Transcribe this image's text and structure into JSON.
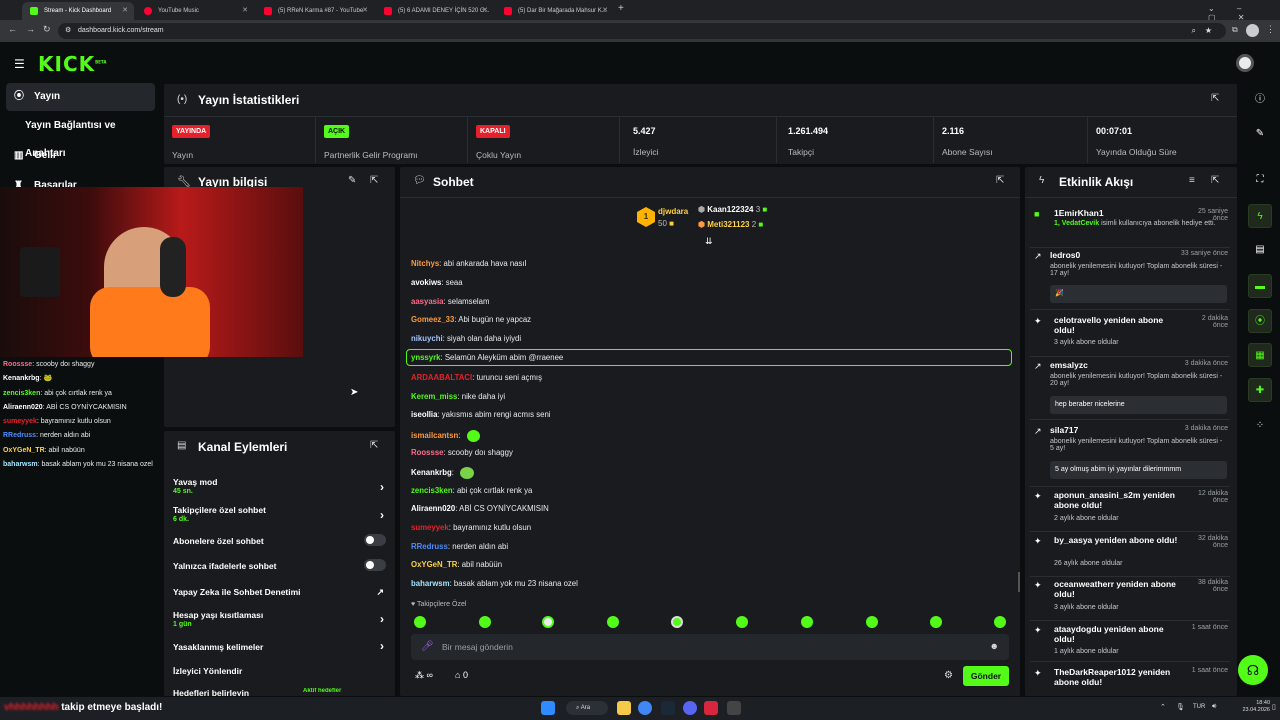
{
  "browser": {
    "tabs": [
      {
        "label": "Stream - Kick Dashboard",
        "color": "#53fc18"
      },
      {
        "label": "YouTube Music",
        "color": "#ff0033"
      },
      {
        "label": "(5) RReN Karma #87 - YouTube",
        "color": "#ff0033"
      },
      {
        "label": "(5) 6 ADAMI DENEY İÇİN 520 G...",
        "color": "#ff0033"
      },
      {
        "label": "(5) Dar Bir Mağarada Mahsur K...",
        "color": "#ff0033"
      }
    ],
    "url": "dashboard.kick.com/stream"
  },
  "header": {
    "logo": "KICK",
    "beta": "BETA"
  },
  "sidebar": {
    "items": [
      {
        "label": "Yayın",
        "icon": "broadcast-icon"
      },
      {
        "label": "Yayın Bağlantısı ve Anahtarı",
        "icon": "key-icon"
      },
      {
        "label": "Gelir",
        "icon": "chart-icon"
      },
      {
        "label": "Başarılar",
        "icon": "trophy-icon"
      }
    ]
  },
  "stats": {
    "title": "Yayın İstatistikleri",
    "items": [
      {
        "badge": "YAYINDA",
        "badge_color": "#e5212b",
        "label": "Yayın"
      },
      {
        "badge": "AÇIK",
        "badge_color": "#53fc18",
        "label": "Partnerlik Gelir Programı"
      },
      {
        "badge": "KAPALI",
        "badge_color": "#e5212b",
        "label": "Çoklu Yayın"
      },
      {
        "value": "5.427",
        "label": "İzleyici"
      },
      {
        "value": "1.261.494",
        "label": "Takipçi"
      },
      {
        "value": "2.116",
        "label": "Abone Sayısı"
      },
      {
        "value": "00:07:01",
        "label": "Yayında Olduğu Süre"
      }
    ]
  },
  "stream_info": {
    "title": "Yayın bilgisi"
  },
  "overlay_chat": [
    {
      "user": "Roossse",
      "color": "#ff6b8b",
      "text": "scooby doı shaggy"
    },
    {
      "user": "Kenankrbg",
      "color": "#ffffff",
      "text": "🐸"
    },
    {
      "user": "zencis3ken",
      "color": "#53fc18",
      "text": "abi çok cırtlak renk ya"
    },
    {
      "user": "Aliraenn020",
      "color": "#ffffff",
      "text": "ABİ CS OYNİYCAKMISIN"
    },
    {
      "user": "sumeyyek",
      "color": "#e5212b",
      "text": "bayramınız kutlu olsun"
    },
    {
      "user": "RRedruss",
      "color": "#4f8cff",
      "text": "nerden aldın abi"
    },
    {
      "user": "OxYGeN_TR",
      "color": "#ffd23f",
      "text": "abil nabüün"
    },
    {
      "user": "baharwsm",
      "color": "#a3e4ff",
      "text": "basak ablam yok mu 23 nisana ozel"
    }
  ],
  "follow_alert": {
    "user": "vhhhhhhhh",
    "text": "takip etmeye başladı!"
  },
  "chat": {
    "title": "Sohbet",
    "leaders": [
      {
        "rank": "1",
        "user": "djwdara",
        "count": "50"
      },
      {
        "user": "Kaan122324",
        "count": "3"
      },
      {
        "user": "Meti321123",
        "count": "2"
      }
    ],
    "messages": [
      {
        "user": "Nitchys",
        "color": "#ff9b3d",
        "text": "abi ankarada hava nasıl"
      },
      {
        "user": "avokiws",
        "color": "#ffffff",
        "text": "seaa"
      },
      {
        "user": "aasyasia",
        "color": "#ff6b8b",
        "text": "selamselam"
      },
      {
        "user": "Gomeez_33",
        "color": "#ff9b3d",
        "text": "Abi bugün ne yapcaz"
      },
      {
        "user": "nikuychi",
        "color": "#a3c4ff",
        "text": "siyah olan daha iyiydi"
      },
      {
        "user": "ynssyrk",
        "color": "#53fc18",
        "text": "Selamün Aleyküm abim @rraenee"
      },
      {
        "user": "ARDAABALTACI",
        "color": "#e5212b",
        "text": "turuncu seni açmış"
      },
      {
        "user": "Kerem_miss",
        "color": "#53fc18",
        "text": "nike daha iyi"
      },
      {
        "user": "iseollia",
        "color": "#ffffff",
        "text": "yakısmıs abim rengi acmıs seni"
      },
      {
        "user": "ismailcantsn",
        "color": "#ff9b3d",
        "text": ""
      },
      {
        "user": "Roossse",
        "color": "#ff6b8b",
        "text": "scooby doı shaggy"
      },
      {
        "user": "Kenankrbg",
        "color": "#ffffff",
        "text": ""
      },
      {
        "user": "zencis3ken",
        "color": "#53fc18",
        "text": "abi çok cırtlak renk ya"
      },
      {
        "user": "Aliraenn020",
        "color": "#ffffff",
        "text": "ABİ CS OYNİYCAKMISIN"
      },
      {
        "user": "sumeyyek",
        "color": "#e5212b",
        "text": "bayramınız kutlu olsun"
      },
      {
        "user": "RRedruss",
        "color": "#4f8cff",
        "text": "nerden aldın abi"
      },
      {
        "user": "OxYGeN_TR",
        "color": "#ffd23f",
        "text": "abil nabüün"
      },
      {
        "user": "baharwsm",
        "color": "#a3e4ff",
        "text": "basak ablam yok mu 23 nisana ozel"
      }
    ],
    "followers_only": "Takipçilere Özel",
    "input_placeholder": "Bir mesaj gönderin",
    "send": "Gönder",
    "gift_count": "0"
  },
  "activity": {
    "title": "Etkinlik Akışı",
    "items": [
      {
        "name": "1EmirKhan1",
        "time": "25 saniye önce",
        "desc_user": "1, VedatCevik",
        "desc": "isimli kullanıcıya abonelik hediye etti."
      },
      {
        "name": "ledros0",
        "time": "33 saniye önce",
        "desc": "abonelik yenilemesini kutluyor! Toplam abonelik süresi - 17 ay!",
        "quote": "🎉"
      },
      {
        "name": "celotravello yeniden abone oldu!",
        "time": "2 dakika önce",
        "desc": "3 aylık abone oldular"
      },
      {
        "name": "emsalyzc",
        "time": "3 dakika önce",
        "desc": "abonelik yenilemesini kutluyor! Toplam abonelik süresi - 20 ay!",
        "quote": "hep beraber nicelerine"
      },
      {
        "name": "sila717",
        "time": "3 dakika önce",
        "desc": "abonelik yenilemesini kutluyor! Toplam abonelik süresi - 5 ay!",
        "quote": "5 ay olmuş abim iyi yayınlar dilerimmmm"
      },
      {
        "name": "aponun_anasini_s2m yeniden abone oldu!",
        "time": "12 dakika önce",
        "desc": "2 aylık abone oldular"
      },
      {
        "name": "by_aasya yeniden abone oldu!",
        "time": "32 dakika önce",
        "desc": "26 aylık abone oldular"
      },
      {
        "name": "oceanweatherr yeniden abone oldu!",
        "time": "38 dakika önce",
        "desc": "3 aylık abone oldular"
      },
      {
        "name": "ataaydogdu yeniden abone oldu!",
        "time": "1 saat önce",
        "desc": "1 aylık abone oldular"
      },
      {
        "name": "TheDarkReaper1012 yeniden abone oldu!",
        "time": "1 saat önce",
        "desc": ""
      }
    ]
  },
  "channel_actions": {
    "title": "Kanal Eylemleri",
    "items": [
      {
        "label": "Yavaş mod",
        "sub": "45 sn."
      },
      {
        "label": "Takipçilere özel sohbet",
        "sub": "6 dk."
      },
      {
        "label": "Abonelere özel sohbet",
        "sub": ""
      },
      {
        "label": "Yalnızca ifadelerle sohbet",
        "sub": ""
      },
      {
        "label": "Yapay Zeka ile Sohbet Denetimi",
        "sub": ""
      },
      {
        "label": "Hesap yaşı kısıtlaması",
        "sub": "1 gün"
      },
      {
        "label": "Yasaklanmış kelimeler",
        "sub": ""
      },
      {
        "label": "İzleyici Yönlendir",
        "sub": ""
      },
      {
        "label": "Hedefleri belirleyin",
        "sub": "Aktif hedefler"
      }
    ]
  },
  "taskbar": {
    "search": "Ara",
    "lang": "TUR",
    "time": "18:40",
    "date": "23.04.2026"
  }
}
